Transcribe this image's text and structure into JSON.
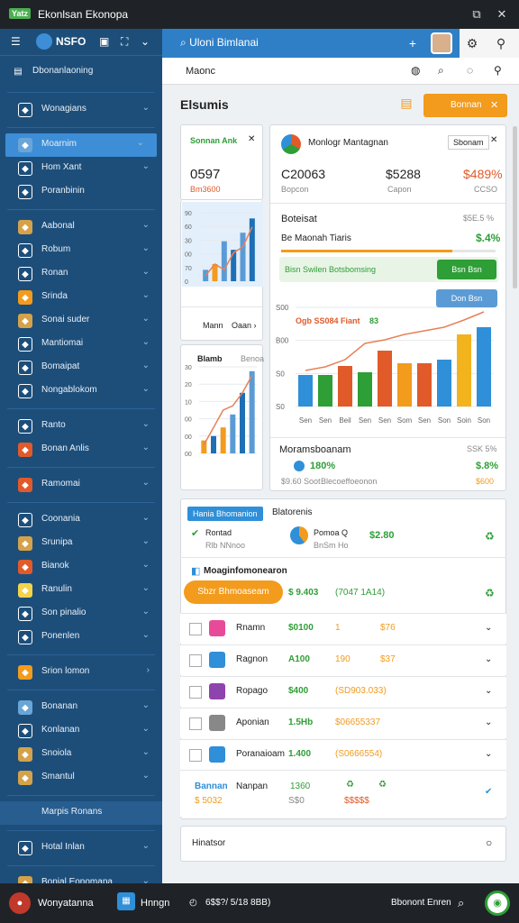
{
  "titlebar": {
    "badge": "Yatz",
    "title": "Ekonlsan Ekonopa"
  },
  "sidebar": {
    "brand": "NSFO",
    "section_title": "Dbonanlaoning",
    "items": [
      {
        "label": "Wonagians",
        "icon": "globe-icon",
        "color": "#ffffff"
      },
      {
        "label": "Moarnim",
        "icon": "user-icon",
        "color": "#6aa5d8"
      },
      {
        "label": "Hom Xant",
        "icon": "check-box-icon",
        "color": "#ffffff"
      },
      {
        "label": "Poranbinin",
        "icon": "chart-icon",
        "color": "#ffffff"
      },
      {
        "label": "Aabonal",
        "icon": "coin-icon",
        "color": "#d4a24a"
      },
      {
        "label": "Robum",
        "icon": "tag-icon",
        "color": "#ffffff"
      },
      {
        "label": "Ronan",
        "icon": "card-icon",
        "color": "#ffffff"
      },
      {
        "label": "Srinda",
        "icon": "folder-icon",
        "color": "#f29b1d"
      },
      {
        "label": "Sonai suder",
        "icon": "chef-icon",
        "color": "#d4a24a"
      },
      {
        "label": "Mantiomai",
        "icon": "settings-icon",
        "color": "#ffffff"
      },
      {
        "label": "Bomaipat",
        "icon": "grid-icon",
        "color": "#ffffff"
      },
      {
        "label": "Nongablokom",
        "icon": "person-icon",
        "color": "#ffffff"
      },
      {
        "label": "Ranto",
        "icon": "table-icon",
        "color": "#ffffff"
      },
      {
        "label": "Bonan Anlis",
        "icon": "target-icon",
        "color": "#e05a2a"
      },
      {
        "label": "Ramomai",
        "icon": "map-pin-icon",
        "color": "#e05a2a"
      },
      {
        "label": "Coonania",
        "icon": "chat-icon",
        "color": "#ffffff"
      },
      {
        "label": "Srunipa",
        "icon": "paw-icon",
        "color": "#d4a24a"
      },
      {
        "label": "Bianok",
        "icon": "leaf-icon",
        "color": "#e05a2a"
      },
      {
        "label": "Ranulin",
        "icon": "book-icon",
        "color": "#f2d34a"
      },
      {
        "label": "Son pinalio",
        "icon": "car-icon",
        "color": "#ffffff"
      },
      {
        "label": "Ponenlen",
        "icon": "mail-icon",
        "color": "#ffffff"
      },
      {
        "label": "Srion lomon",
        "icon": "bag-icon",
        "color": "#f29b1d"
      },
      {
        "label": "Bonanan",
        "icon": "cloud-icon",
        "color": "#6aa5d8"
      },
      {
        "label": "Konlanan",
        "icon": "clipboard-icon",
        "color": "#ffffff"
      },
      {
        "label": "Snoiola",
        "icon": "fish-icon",
        "color": "#d4a24a"
      },
      {
        "label": "Smantul",
        "icon": "bowl-icon",
        "color": "#d4a24a"
      },
      {
        "label": "Marpis Ronans",
        "icon": "",
        "color": "#ffffff"
      },
      {
        "label": "Hotal Inlan",
        "icon": "camera-icon",
        "color": "#ffffff"
      },
      {
        "label": "Bonial Eonomapa",
        "icon": "store-icon",
        "color": "#d4a24a"
      }
    ]
  },
  "topbar": {
    "search_text": "Uloni Bimlanai"
  },
  "subbar": {
    "title": "Maonc"
  },
  "page": {
    "title": "Elsumis",
    "action_button": "Bonnan"
  },
  "card_left": {
    "title": "Sonnan Ank",
    "value": "0597",
    "sub": "Bm3600",
    "footer_label": "Mann",
    "footer_link": "Oaan"
  },
  "card_main": {
    "title": "Monlogr Mantagnan",
    "tag": "Sbonam",
    "stats": [
      {
        "value": "C20063",
        "label": "Bopcon"
      },
      {
        "value": "$5288",
        "label": "Capon"
      },
      {
        "value": "$489%",
        "label": "CCSO"
      }
    ],
    "sec_title": "Boteisat",
    "sec_value": "$5E.5 %",
    "sec_sub": "Be Maonah Tiaris",
    "sec_pct": "$.4%",
    "progress": 0.8,
    "bar_label": "Bisn Swilen Botsbomsing",
    "bar_btn": "Bsn Bsn",
    "chart_btn": "Don Bsn",
    "chart_label": "Ogb SS084 Fiant",
    "chart_label_val": "83",
    "bottom_title": "Moramsboanam",
    "bottom_right": "SSK 5%",
    "bottom_value": "180%",
    "bottom_sub": "$9.60 Soot",
    "bottom_note": "Blecoeffoeonon",
    "bottom_pct": "$.8%",
    "bottom_pct2": "$600"
  },
  "card_small": {
    "title": "Blamb",
    "tag": "Benoa"
  },
  "chart_data": [
    {
      "type": "bar",
      "title": "",
      "categories": [
        "",
        "",
        "",
        "",
        "",
        ""
      ],
      "values": [
        20,
        30,
        70,
        55,
        85,
        110
      ],
      "ylim": [
        0,
        120
      ],
      "yticks": [
        "90",
        "60",
        "30",
        "00",
        "70",
        "0"
      ],
      "colors": [
        "#5b9bd5",
        "#f29b1d",
        "#5b9bd5",
        "#1f6fb5",
        "#5b9bd5",
        "#1f6fb5"
      ],
      "line": [
        10,
        30,
        20,
        50,
        60,
        95
      ]
    },
    {
      "type": "bar",
      "title": "",
      "categories": [
        "",
        "",
        "",
        "",
        "",
        ""
      ],
      "values": [
        15,
        20,
        30,
        45,
        70,
        95
      ],
      "ylim": [
        0,
        100
      ],
      "yticks": [
        "30",
        "20",
        "10",
        "00",
        "00",
        "00"
      ],
      "colors": [
        "#f29b1d",
        "#1f6fb5",
        "#f29b1d",
        "#5b9bd5",
        "#1f6fb5",
        "#5b9bd5"
      ],
      "line": [
        10,
        30,
        50,
        55,
        70,
        90
      ]
    },
    {
      "type": "bar",
      "title": "",
      "categories": [
        "Sen",
        "Sen",
        "Beil",
        "Sen",
        "Sen",
        "Som",
        "Sen",
        "Son",
        "Soin",
        "Son"
      ],
      "values": [
        35,
        35,
        45,
        38,
        62,
        48,
        48,
        52,
        80,
        88
      ],
      "ylim": [
        0,
        110
      ],
      "yticks": [
        "S00",
        "B00",
        "S0",
        "S0"
      ],
      "colors": [
        "#2f8fd8",
        "#2e9e36",
        "#e05a2a",
        "#2e9e36",
        "#e05a2a",
        "#f29b1d",
        "#e05a2a",
        "#2f8fd8",
        "#f2b31d",
        "#2f8fd8"
      ],
      "line": [
        40,
        44,
        52,
        70,
        74,
        80,
        84,
        88,
        96,
        105
      ]
    }
  ],
  "list": {
    "tab_label": "Hania Bhomanion",
    "tab_title": "Blatorenis",
    "top_item": {
      "label": "Rontad",
      "sub": "Rlb NNnoo",
      "name": "Pomoa Q",
      "name_sub": "BnSm Ho",
      "value": "$2.80"
    },
    "section": {
      "title": "Moaginfomonearon",
      "button": "Sbzr Bhmoaseam",
      "val1": "$ 9.403",
      "val2": "(7047 1A14)"
    },
    "rows": [
      {
        "icon_color": "#e84a9a",
        "name": "Rnamn",
        "a": "$0100",
        "b": "1",
        "c": "$76"
      },
      {
        "icon_color": "#2f8fd8",
        "name": "Ragnon",
        "a": "A100",
        "b": "190",
        "c": "$37"
      },
      {
        "icon_color": "#8e44ad",
        "name": "Ropago",
        "a": "$400",
        "b": "(SD903.033)",
        "c": ""
      },
      {
        "icon_color": "#888888",
        "name": "Aponian",
        "a": "1.5Hb",
        "b": "$06655337",
        "c": ""
      },
      {
        "icon_color": "#2f8fd8",
        "name": "Poranaioam",
        "a": "1.400",
        "b": "(S0666554)",
        "c": ""
      }
    ],
    "last_row": {
      "name": "Nanpan",
      "left": "Bannan",
      "left_sub": "$ 5032",
      "a": "1360",
      "a_sub": "S$0",
      "b": "$$$$$"
    },
    "bottom_input": "Hinatsor"
  },
  "footer": {
    "user": "Wonyatanna",
    "app": "Hnngn",
    "clock": "6$$?/ 5/18 8BB)",
    "right": "Bbonont Enren"
  },
  "colors": {
    "sidebar": "#1d4e7a",
    "accent": "#2f7fc7",
    "orange": "#f29b1d",
    "green": "#2e9e36"
  }
}
